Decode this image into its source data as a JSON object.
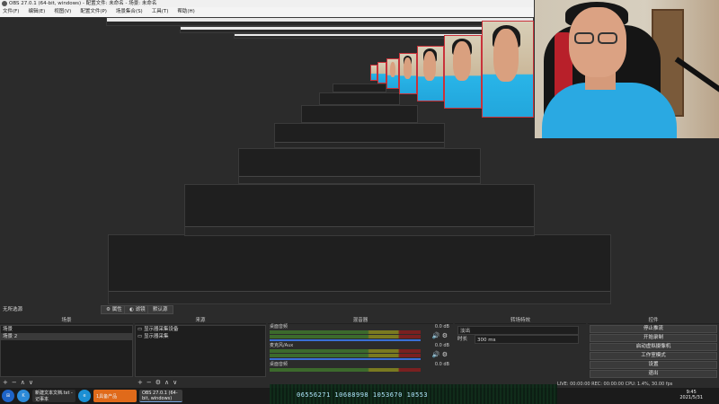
{
  "window": {
    "title": "OBS 27.0.1 (64-bit, windows) - 配置文件: 未命名 - 场景: 未命名"
  },
  "menu": [
    "文件(F)",
    "编辑(E)",
    "视图(V)",
    "配置文件(P)",
    "场景集合(S)",
    "工具(T)",
    "帮助(H)"
  ],
  "source_toolbar": {
    "label": "无所选源",
    "properties": "属性",
    "filters": "滤镜",
    "default_scene": "默认源"
  },
  "scenes": {
    "title": "场景",
    "items": [
      "场景",
      "场景 2"
    ],
    "selected": 1
  },
  "sources": {
    "title": "来源",
    "items": [
      "显示器采集设备",
      "显示器采集"
    ]
  },
  "mixer": {
    "title": "混音器",
    "channels": [
      {
        "name": "桌面音频",
        "db": "0.0 dB"
      },
      {
        "name": "麦克风/Aux",
        "db": "0.0 dB"
      },
      {
        "name": "桌面音频",
        "db": "0.0 dB"
      }
    ]
  },
  "transitions": {
    "title": "转场特效",
    "type": "淡出",
    "duration_label": "时长",
    "duration_value": "300 ms"
  },
  "controls": {
    "title": "控件",
    "buttons": [
      "停止推流",
      "开始录制",
      "启动虚拟摄像机",
      "工作室模式",
      "设置",
      "退出"
    ]
  },
  "taskbar": {
    "obs_label": "OBS 27.0.1 (64-bit, windows)",
    "file_label": "新建文本文档.txt - 记事本",
    "app_label": "1具备产品",
    "ticker": "06556271 10688998 1053670 10553"
  },
  "status": {
    "text": "LIVE: 00:00:00   REC: 00:00:00   CPU: 1.4%, 30.00 fps"
  },
  "clock": {
    "time": "9:45",
    "date": "2021/5/31"
  }
}
